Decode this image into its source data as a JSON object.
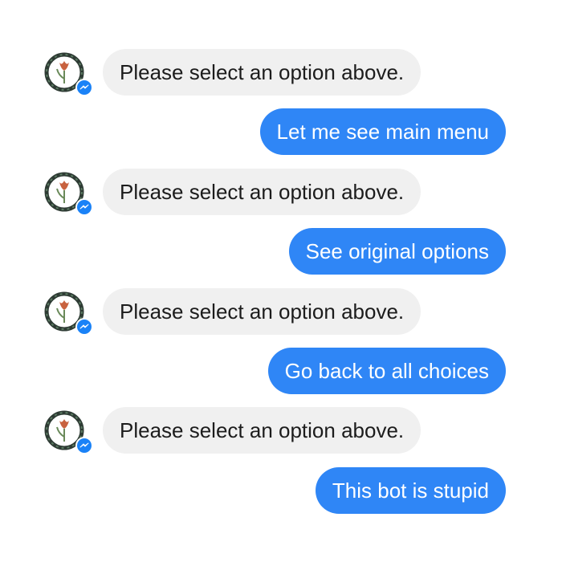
{
  "conversation": {
    "messages": [
      {
        "sender": "bot",
        "text": "Please select an option above."
      },
      {
        "sender": "user",
        "text": "Let me see main menu"
      },
      {
        "sender": "bot",
        "text": "Please select an option above."
      },
      {
        "sender": "user",
        "text": "See original options"
      },
      {
        "sender": "bot",
        "text": "Please select an option above."
      },
      {
        "sender": "user",
        "text": "Go back to all choices"
      },
      {
        "sender": "bot",
        "text": "Please select an option above."
      },
      {
        "sender": "user",
        "text": "This bot is stupid"
      }
    ]
  },
  "colors": {
    "user_bubble": "#2f86f6",
    "bot_bubble": "#f0f0f0",
    "messenger_badge": "#1a82f7",
    "avatar_ring": "#2e3b34",
    "tulip_petal": "#c8623f"
  },
  "icons": {
    "bot_avatar": "tulip-logo-icon",
    "badge": "messenger-icon"
  }
}
